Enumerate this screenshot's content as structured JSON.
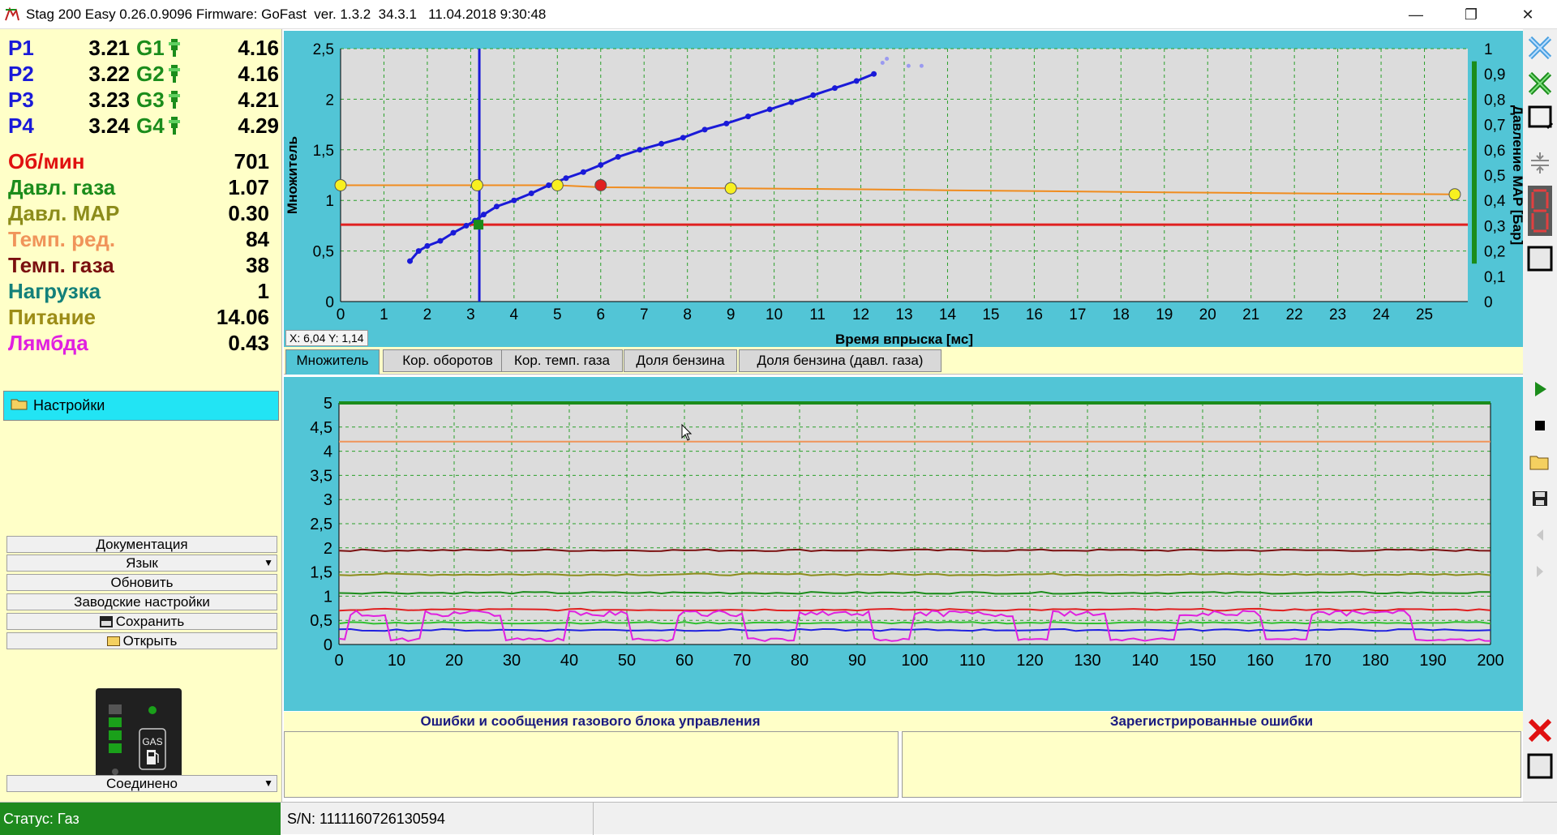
{
  "window": {
    "title": "Stag 200 Easy 0.26.0.9096 Firmware: GoFast  ver. 1.3.2  34.3.1   11.04.2018 9:30:48",
    "minimize": "—",
    "maximize": "❐",
    "close": "✕"
  },
  "injectors": [
    {
      "p_label": "P1",
      "p_value": "3.21",
      "g_label": "G1",
      "g_value": "4.16"
    },
    {
      "p_label": "P2",
      "p_value": "3.22",
      "g_label": "G2",
      "g_value": "4.16"
    },
    {
      "p_label": "P3",
      "p_value": "3.23",
      "g_label": "G3",
      "g_value": "4.21"
    },
    {
      "p_label": "P4",
      "p_value": "3.24",
      "g_label": "G4",
      "g_value": "4.29"
    }
  ],
  "sensors": [
    {
      "label": "Об/мин",
      "value": "701",
      "color": "#e01010"
    },
    {
      "label": "Давл. газа",
      "value": "1.07",
      "color": "#1b8c1b"
    },
    {
      "label": "Давл. MAP",
      "value": "0.30",
      "color": "#8c8c1a"
    },
    {
      "label": "Темп. ред.",
      "value": "84",
      "color": "#f0945a"
    },
    {
      "label": "Темп. газа",
      "value": "38",
      "color": "#7a0f0f"
    },
    {
      "label": "Нагрузка",
      "value": "1",
      "color": "#13807a"
    },
    {
      "label": "Питание",
      "value": "14.06",
      "color": "#9c8c16"
    },
    {
      "label": "Лямбда",
      "value": "0.43",
      "color": "#e020e0"
    }
  ],
  "settings_label": "Настройки",
  "menu": {
    "documentation": "Документация",
    "language": "Язык",
    "refresh": "Обновить",
    "factory": "Заводские настройки",
    "save": "Сохранить",
    "open": "Открыть",
    "connection": "Соединено"
  },
  "gas_indicator": {
    "label": "GAS",
    "levels_on": 4,
    "levels_total": 5
  },
  "status": {
    "mode": "Статус: Газ",
    "serial": "S/N: 1111160726130594"
  },
  "tabs": [
    {
      "label": "Множитель",
      "active": true
    },
    {
      "label": "Кор. оборотов",
      "active": false
    },
    {
      "label": "Кор. темп. газа",
      "active": false
    },
    {
      "label": "Доля бензина",
      "active": false
    },
    {
      "label": "Доля бензина (давл. газа)",
      "active": false
    }
  ],
  "cursor_readout": "X: 6,04  Y: 1,14",
  "errors": {
    "ecu_messages_title": "Ошибки и сообщения газового блока управления",
    "registered_title": "Зарегистрированные ошибки"
  },
  "chart_data": [
    {
      "type": "scatter",
      "xlabel": "Время впрыска [мс]",
      "ylabel": "Множитель",
      "y2label": "Давление MAP [Бар]",
      "xlim": [
        0,
        26
      ],
      "ylim": [
        0,
        2.5
      ],
      "y2lim": [
        0,
        1
      ],
      "xticks": [
        "0",
        "1",
        "2",
        "3",
        "4",
        "5",
        "6",
        "7",
        "8",
        "9",
        "10",
        "11",
        "12",
        "13",
        "14",
        "15",
        "16",
        "17",
        "18",
        "19",
        "20",
        "21",
        "22",
        "23",
        "24",
        "25"
      ],
      "yticks": [
        "0",
        "0,5",
        "1",
        "1,5",
        "2",
        "2,5"
      ],
      "y2ticks": [
        "0",
        "0,1",
        "0,2",
        "0,3",
        "0,4",
        "0,5",
        "0,6",
        "0,7",
        "0,8",
        "0,9",
        "1"
      ],
      "grid": true,
      "series": [
        {
          "color": "#1a1ad8",
          "x": [
            1.6,
            1.8,
            2,
            2.3,
            2.6,
            2.9,
            3.1,
            3.3,
            3.6,
            4,
            4.4,
            4.8,
            5.2,
            5.6,
            6,
            6.4,
            6.9,
            7.4,
            7.9,
            8.4,
            8.9,
            9.4,
            9.9,
            10.4,
            10.9,
            11.4,
            11.9,
            12.3
          ],
          "y": [
            0.4,
            0.5,
            0.55,
            0.6,
            0.68,
            0.75,
            0.8,
            0.86,
            0.94,
            1,
            1.07,
            1.15,
            1.22,
            1.28,
            1.35,
            1.43,
            1.5,
            1.56,
            1.62,
            1.7,
            1.76,
            1.83,
            1.9,
            1.97,
            2.04,
            2.11,
            2.18,
            2.25
          ]
        },
        {
          "color": "#9a9af0",
          "x": [
            12.5,
            12.6,
            13.1,
            13.4
          ],
          "y": [
            2.36,
            2.4,
            2.33,
            2.33
          ]
        },
        {
          "color": "#f08c1e",
          "x": [
            0,
            3.2,
            5,
            6,
            9,
            12,
            14,
            19,
            22,
            25.7
          ],
          "y": [
            1.15,
            1.15,
            1.15,
            1.13,
            1.12,
            1.11,
            1.1,
            1.08,
            1.07,
            1.06
          ]
        },
        {
          "color": "#e02020",
          "x": [
            0,
            26
          ],
          "y": [
            0.76,
            0.76
          ]
        }
      ],
      "markers": [
        {
          "x": 0,
          "y": 1.15,
          "color": "#f8f020"
        },
        {
          "x": 3.15,
          "y": 1.15,
          "color": "#f8f020"
        },
        {
          "x": 5,
          "y": 1.15,
          "color": "#f8f020"
        },
        {
          "x": 6,
          "y": 1.15,
          "color": "#e02020"
        },
        {
          "x": 9,
          "y": 1.12,
          "color": "#f8f020"
        },
        {
          "x": 25.7,
          "y": 1.06,
          "color": "#f8f020"
        }
      ],
      "cursor_x": 3.2,
      "map_bar": {
        "from": 0.15,
        "to": 0.95
      }
    },
    {
      "type": "line",
      "xlim": [
        0,
        200
      ],
      "ylim": [
        0,
        5
      ],
      "xticks": [
        "0",
        "10",
        "20",
        "30",
        "40",
        "50",
        "60",
        "70",
        "80",
        "90",
        "100",
        "110",
        "120",
        "130",
        "140",
        "150",
        "160",
        "170",
        "180",
        "190",
        "200"
      ],
      "yticks": [
        "0",
        "0,5",
        "1",
        "1,5",
        "2",
        "2,5",
        "3",
        "3,5",
        "4",
        "4,5",
        "5"
      ],
      "grid": true,
      "series": [
        {
          "color": "#1b8c1b",
          "value": 5.0
        },
        {
          "color": "#f0945a",
          "value": 4.2
        },
        {
          "color": "#7a0f0f",
          "value": 1.95
        },
        {
          "color": "#8c8c1a",
          "value": 1.45
        },
        {
          "color": "#1b8c1b",
          "value": 1.07
        },
        {
          "color": "#e02020",
          "value": 0.72
        },
        {
          "color": "#30c030",
          "value": 0.45
        },
        {
          "color": "#2020e0",
          "value": 0.3
        },
        {
          "color": "#e020e0",
          "pattern": "lambda",
          "low": 0.1,
          "high": 0.7
        }
      ]
    }
  ]
}
